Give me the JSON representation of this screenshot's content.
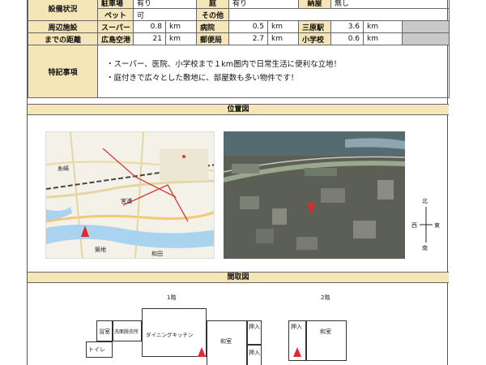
{
  "facilities": {
    "label": "設備状況",
    "row1": {
      "k1": "駐車場",
      "v1": "有り",
      "k2": "庭",
      "v2": "有り",
      "k3": "納屋",
      "v3": "無し"
    },
    "row2": {
      "k1": "ペット",
      "v1": "可",
      "k2": "その他",
      "v2": ""
    }
  },
  "nearby": {
    "label_line1": "周辺施設",
    "label_line2": "までの距離",
    "rows": [
      [
        {
          "name": "スーパー",
          "val": "0.8",
          "unit": "km"
        },
        {
          "name": "病院",
          "val": "0.5",
          "unit": "km"
        },
        {
          "name": "三原駅",
          "val": "3.6",
          "unit": "km"
        }
      ],
      [
        {
          "name": "広島空港",
          "val": "21",
          "unit": "km"
        },
        {
          "name": "郵便局",
          "val": "2.7",
          "unit": "km"
        },
        {
          "name": "小学校",
          "val": "0.6",
          "unit": "km"
        }
      ]
    ]
  },
  "notes": {
    "label": "特記事項",
    "lines": [
      "・スーパー、医院、小学校まで１km圏内で日常生活に便利な立地！",
      "・庭付きで広々とした敷地に、部屋数も多い物件です！"
    ]
  },
  "location": {
    "title": "位置図",
    "compass": {
      "n": "北",
      "s": "南",
      "e": "東",
      "w": "西"
    },
    "map_labels": [
      "糸崎",
      "宮浦",
      "和田",
      "築地"
    ]
  },
  "floorplan": {
    "title": "間取図",
    "floor1": "1階",
    "floor2": "2階",
    "rooms": {
      "bath": "浴室",
      "wash": "洗面脱衣所",
      "dining": "ダイニングキッチン",
      "toilet": "トイレ",
      "washitsu1": "和室",
      "oshiire1": "押入",
      "oshiire2": "押入",
      "oshiire3": "押入",
      "washitsu2": "和室"
    }
  },
  "colors": {
    "header_bg": "#f5e6b8",
    "grey_cell": "#c9c9c9",
    "marker": "#e0282f"
  }
}
